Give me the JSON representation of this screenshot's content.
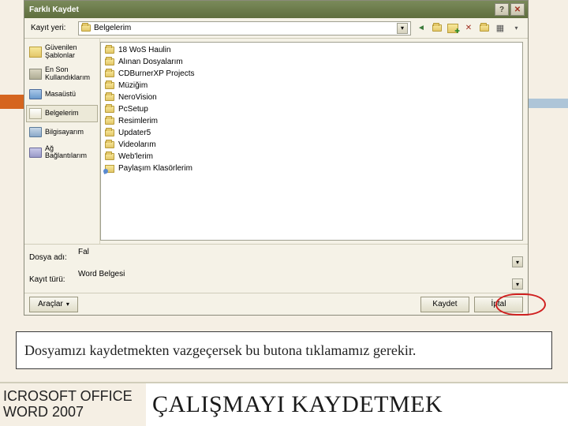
{
  "dialog": {
    "title": "Farklı Kaydet",
    "save_in_label": "Kayıt yeri:",
    "save_in_value": "Belgelerim",
    "filename_label": "Dosya adı:",
    "filename_value": "Fal",
    "filetype_label": "Kayıt türü:",
    "filetype_value": "Word Belgesi",
    "tools_label": "Araçlar",
    "save_label": "Kaydet",
    "cancel_label": "İptal"
  },
  "sidebar": {
    "items": [
      {
        "label": "Güvenilen Şablonlar"
      },
      {
        "label": "En Son Kullandıklarım"
      },
      {
        "label": "Masaüstü"
      },
      {
        "label": "Belgelerim"
      },
      {
        "label": "Bilgisayarım"
      },
      {
        "label": "Ağ Bağlantılarım"
      }
    ]
  },
  "files": {
    "items": [
      {
        "label": "18 WoS Haulin"
      },
      {
        "label": "Alınan Dosyalarım"
      },
      {
        "label": "CDBurnerXP Projects"
      },
      {
        "label": "Müziğim"
      },
      {
        "label": "NeroVision"
      },
      {
        "label": "PcSetup"
      },
      {
        "label": "Resimlerim"
      },
      {
        "label": "Updater5"
      },
      {
        "label": "Videolarım"
      },
      {
        "label": "Web'lerim"
      },
      {
        "label": "Paylaşım Klasörlerim"
      }
    ]
  },
  "caption": "Dosyamızı kaydetmekten vazgeçersek bu butona tıklamamız gerekir.",
  "footer": {
    "brand_line1": "ICROSOFT OFFICE",
    "brand_line2": "WORD 2007",
    "heading": "ÇALIŞMAYI KAYDETMEK"
  }
}
